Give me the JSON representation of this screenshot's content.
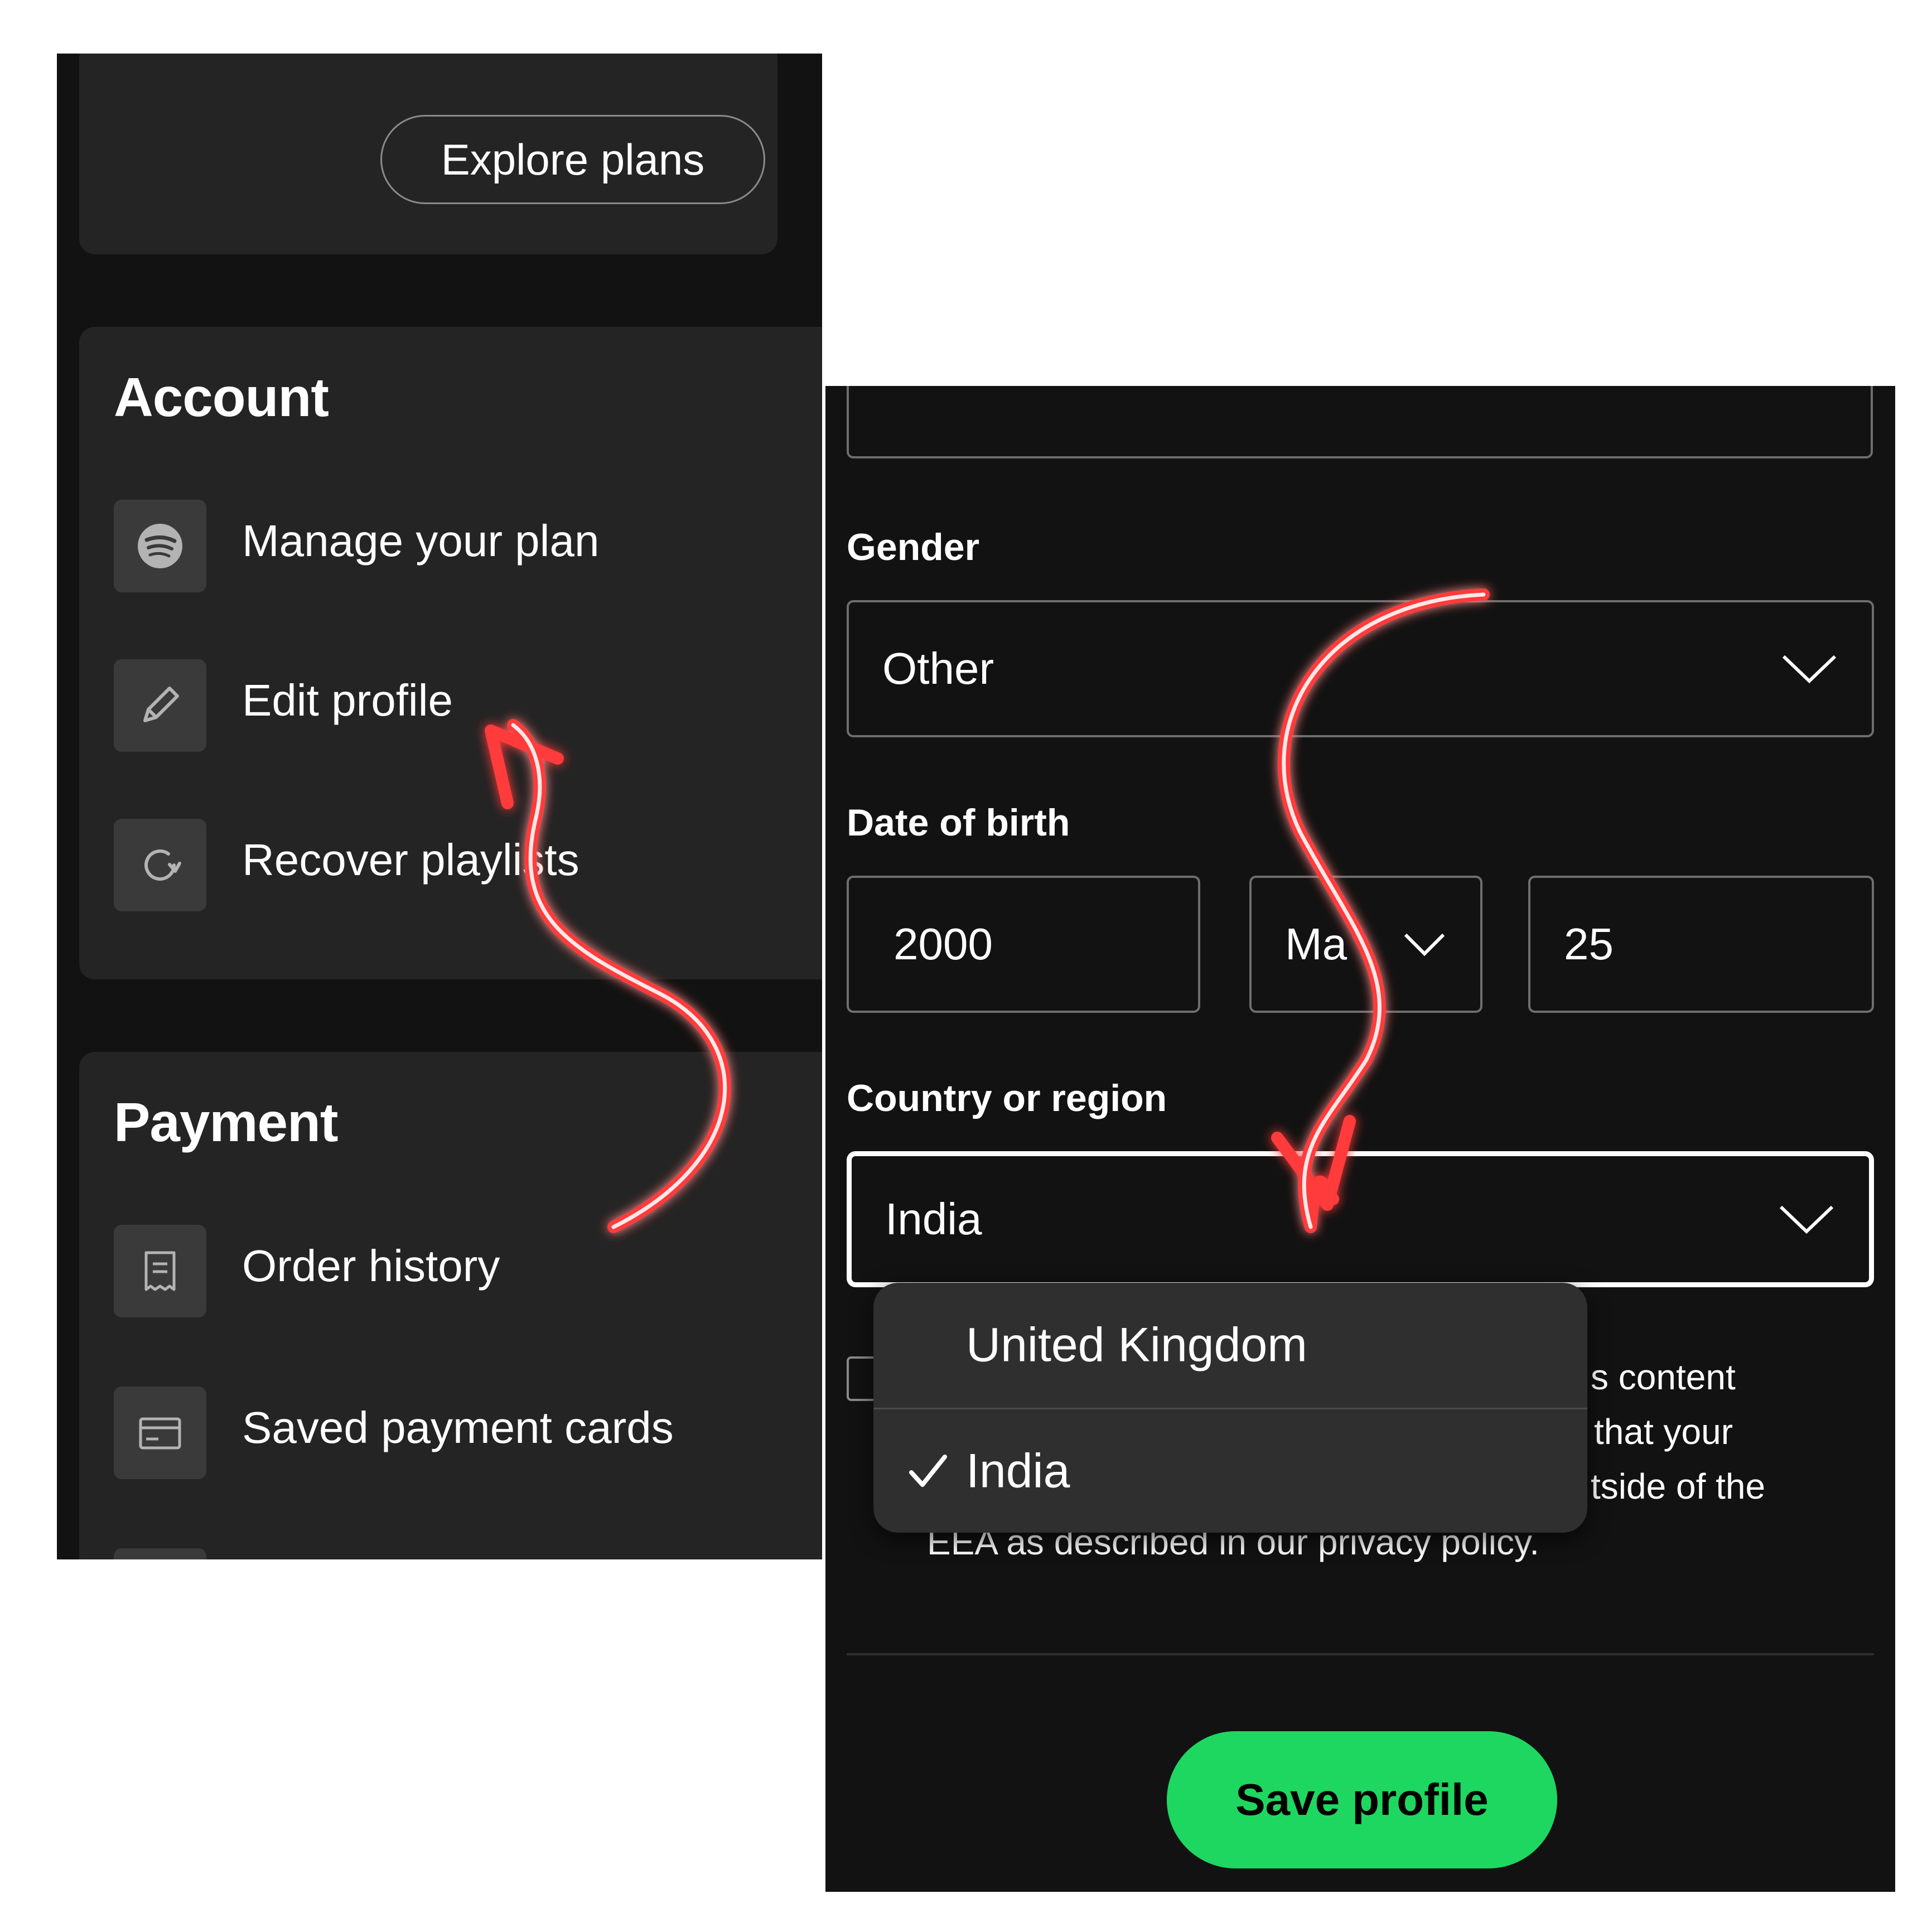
{
  "left_panel": {
    "plan_card": {
      "explore_label": "Explore plans"
    },
    "account": {
      "title": "Account",
      "items": [
        {
          "label": "Manage your plan",
          "icon": "spotify-logo-icon"
        },
        {
          "label": "Edit profile",
          "icon": "pencil-icon"
        },
        {
          "label": "Recover playlists",
          "icon": "refresh-icon"
        }
      ]
    },
    "payment": {
      "title": "Payment",
      "items": [
        {
          "label": "Order history",
          "icon": "receipt-icon"
        },
        {
          "label": "Saved payment cards",
          "icon": "credit-card-icon"
        }
      ]
    }
  },
  "right_panel": {
    "gender": {
      "label": "Gender",
      "value": "Other"
    },
    "dob": {
      "label": "Date of birth",
      "year": "2000",
      "month": "Ma",
      "day": "25"
    },
    "country": {
      "label": "Country or region",
      "value": "India",
      "options": [
        {
          "label": "United Kingdom",
          "selected": false
        },
        {
          "label": "India",
          "selected": true
        }
      ]
    },
    "consent_fragments": [
      "s content",
      "that your",
      "tside of the",
      "EEA as described in our privacy policy."
    ],
    "save_label": "Save profile"
  },
  "colors": {
    "background": "#121212",
    "card": "#242424",
    "accent_green": "#1ed760",
    "arrow_red": "#ff3b3b",
    "purple_edge": "#7a1a5a"
  }
}
